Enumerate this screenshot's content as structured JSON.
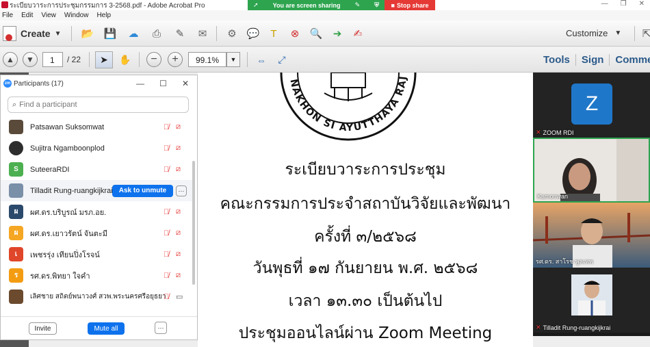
{
  "window": {
    "title": "ระเบียบวาระการประชุมกรรมการ 3-2568.pdf - Adobe Acrobat Pro",
    "minimize": "—",
    "restore": "❐",
    "close": "✕"
  },
  "share_banner": {
    "label": "You are screen sharing",
    "stop_label": "Stop share",
    "color": "#2ea44f",
    "stop_color": "#e53935"
  },
  "menu": [
    "File",
    "Edit",
    "View",
    "Window",
    "Help"
  ],
  "toolbar": {
    "create_label": "Create",
    "customize_label": "Customize"
  },
  "nav": {
    "page_current": "1",
    "page_total": "/ 22",
    "zoom": "99.1%",
    "tabs": [
      "Tools",
      "Sign",
      "Comment"
    ]
  },
  "participants": {
    "header": "Participants (17)",
    "search_placeholder": "Find a participant",
    "list": [
      {
        "name": "Patsawan Suksomwat",
        "initial": "",
        "color": "#5a4a3a"
      },
      {
        "name": "Sujitra Ngamboonplod",
        "initial": "",
        "color": "#2e2e2e"
      },
      {
        "name": "SuteeraRDI",
        "initial": "S",
        "color": "#4caf50"
      },
      {
        "name": "Tilladit Rung-ruangkijkrai",
        "initial": "",
        "color": "#7a8fa8"
      },
      {
        "name": "ผศ.ดร.บริบูรณ์ มรภ.อย.",
        "initial": "ผ",
        "color": "#2b4a6b"
      },
      {
        "name": "ผศ.ดร.เยาวรัตน์ จันตะมี",
        "initial": "ผ",
        "color": "#f5a623"
      },
      {
        "name": "เพชรรุ่ง เทียนปิ่งโรจน์",
        "initial": "เ",
        "color": "#e0462a"
      },
      {
        "name": "รศ.ดร.พิทยา ใจคำ",
        "initial": "ร",
        "color": "#f39c12"
      },
      {
        "name": "เลิศชาย สถิตย์พนาวงศ์ สวพ.พระนครศรีอยุธยา",
        "initial": "",
        "color": "#6b4a2e"
      }
    ],
    "ask_unmute": "Ask to unmute",
    "more": "···",
    "invite": "Invite",
    "mute_all": "Mute all"
  },
  "document": {
    "lines": [
      "ระเบียบวาระการประชุม",
      "คณะกรรมการประจำสถาบันวิจัยและพัฒนา",
      "ครั้งที่ ๓/๒๕๖๘",
      "วันพุธที่ ๑๗ กันยายน พ.ศ. ๒๕๖๘",
      "เวลา ๑๓.๓๐ เป็นต้นไป",
      "ประชุมออนไลน์ผ่าน Zoom Meeting"
    ],
    "seal_text": "NAKHON SI AYUTTHAYA RAJABHAT UNIV"
  },
  "gallery": [
    {
      "label": "ZOOM RDI",
      "avatar": "Z",
      "muted": true
    },
    {
      "label": "Kamonwan",
      "muted": false
    },
    {
      "label": "รศ.ดร. สาโรช พูลเทพ",
      "muted": false
    },
    {
      "label": "Tilladit Rung-ruangkijkrai",
      "muted": true
    }
  ]
}
